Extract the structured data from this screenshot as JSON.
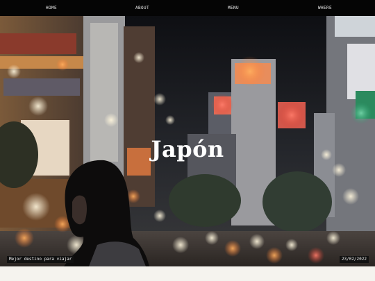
{
  "nav": {
    "items": [
      {
        "label": "HOME"
      },
      {
        "label": "ABOUT"
      },
      {
        "label": "MENU"
      },
      {
        "label": "WHERE"
      }
    ]
  },
  "hero": {
    "title": "Japón",
    "caption": "Mejor destino para viajar",
    "date": "23/02/2022",
    "image_subject": "night city street with neon billboards and woman silhouette"
  },
  "colors": {
    "nav_bg": "#050505",
    "nav_text": "#f1f1f1",
    "page_bg": "#f5f3ee",
    "label_bg": "#111111"
  }
}
